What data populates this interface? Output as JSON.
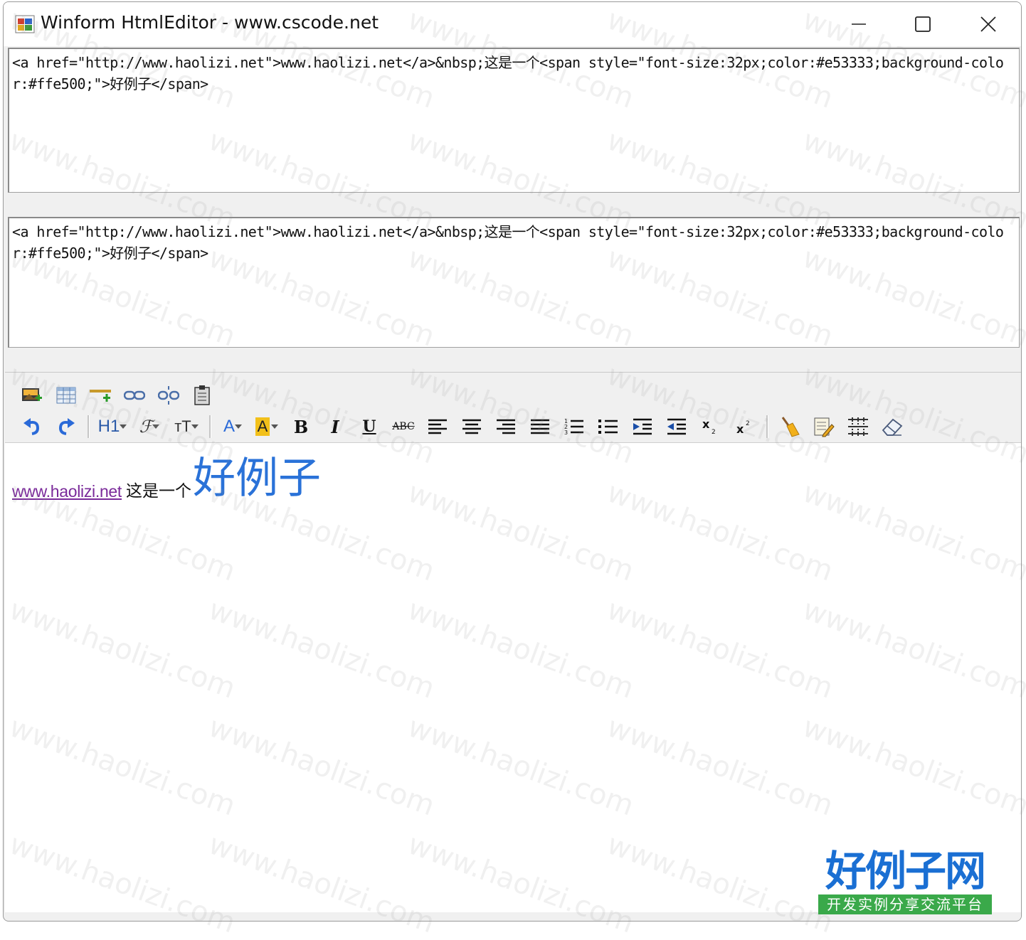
{
  "window": {
    "title": "Winform HtmlEditor - www.cscode.net"
  },
  "source_box_1": {
    "text": "<a href=\"http://www.haolizi.net\">www.haolizi.net</a>&nbsp;这是一个<span style=\"font-size:32px;color:#e53333;background-color:#ffe500;\">好例子</span>"
  },
  "source_box_2": {
    "text": "<a href=\"http://www.haolizi.net\">www.haolizi.net</a>&nbsp;这是一个<span style=\"font-size:32px;color:#e53333;background-color:#ffe500;\">好例子</span>"
  },
  "toolbar": {
    "heading_label": "H1",
    "font_label": "ℱ",
    "size_label": "тT",
    "font_color_label": "A",
    "highlight_label": "A",
    "bold_label": "B",
    "italic_label": "I",
    "underline_label": "U",
    "strike_label": "ABC"
  },
  "editor": {
    "link_text": "www.haolizi.net",
    "plain_text": "这是一个",
    "big_text": "好例子"
  },
  "watermark": {
    "text": "www.haolizi.com"
  },
  "logo": {
    "main": "好例子网",
    "sub": "开发实例分享交流平台"
  },
  "colors": {
    "link": "#7a2a9a",
    "big_text": "#2a72d8",
    "logo_blue": "#1a6fd3",
    "logo_green": "#3aa94a"
  }
}
